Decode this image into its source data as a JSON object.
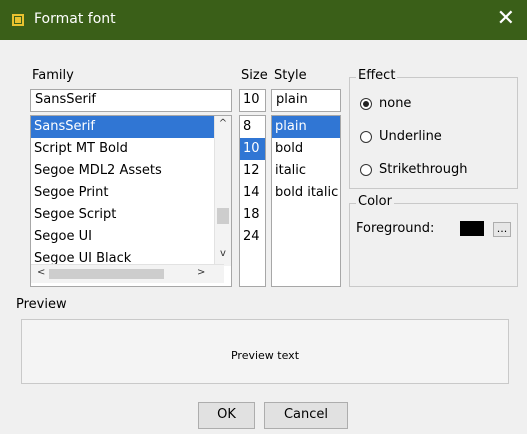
{
  "window": {
    "title": "Format font",
    "icon": "font-icon",
    "close_glyph": "✕",
    "titlebar_color": "#3a5f18"
  },
  "family": {
    "label": "Family",
    "value": "SansSerif",
    "items": [
      "SansSerif",
      "Script MT Bold",
      "Segoe MDL2 Assets",
      "Segoe Print",
      "Segoe Script",
      "Segoe UI",
      "Segoe UI Black"
    ],
    "selected": "SansSerif"
  },
  "size": {
    "label": "Size",
    "value": "10",
    "items": [
      "8",
      "10",
      "12",
      "14",
      "18",
      "24"
    ],
    "selected": "10"
  },
  "style": {
    "label": "Style",
    "value": "plain",
    "items": [
      "plain",
      "bold",
      "italic",
      "bold italic"
    ],
    "selected": "plain"
  },
  "effect": {
    "title": "Effect",
    "options": [
      {
        "label": "none",
        "checked": true
      },
      {
        "label": "Underline",
        "checked": false
      },
      {
        "label": "Strikethrough",
        "checked": false
      }
    ]
  },
  "color": {
    "title": "Color",
    "foreground_label": "Foreground:",
    "foreground_value": "#000000",
    "picker_label": "..."
  },
  "preview": {
    "title": "Preview",
    "text": "Preview text"
  },
  "buttons": {
    "ok": "OK",
    "cancel": "Cancel"
  },
  "scroll_glyphs": {
    "up": "^",
    "down": "v",
    "left": "<",
    "right": ">"
  },
  "selection_color": "#3076d4"
}
